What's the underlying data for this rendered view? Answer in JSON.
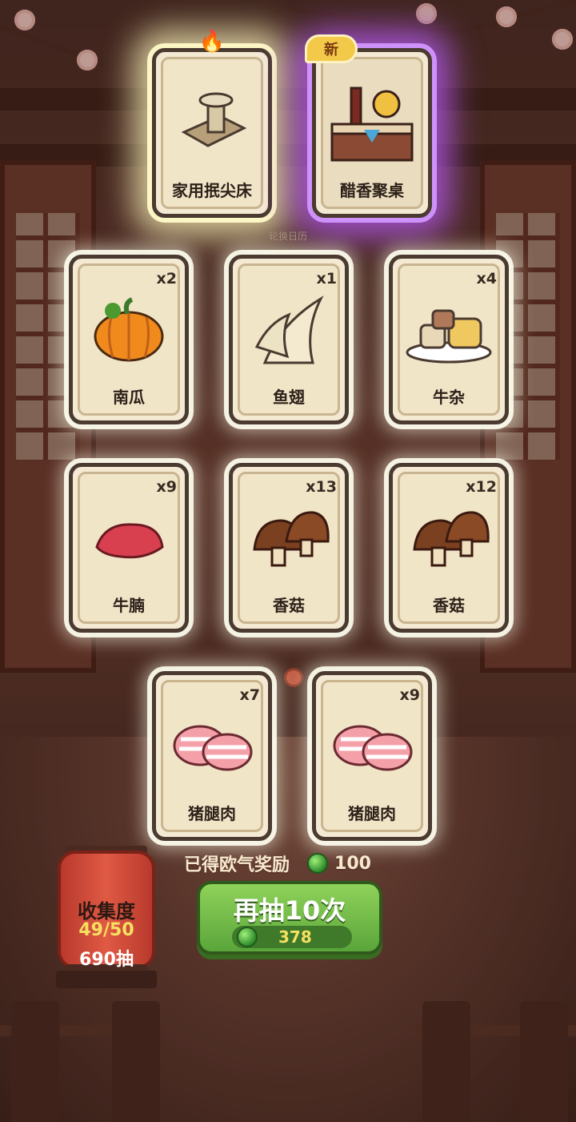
{
  "top_cards": [
    {
      "label": "家用抿尖床",
      "badge": "",
      "effect": "gold",
      "icon": "noodle-press-icon"
    },
    {
      "label": "醋香聚桌",
      "badge": "新",
      "effect": "purple",
      "icon": "vinegar-table-icon"
    }
  ],
  "calendar_label": "轮换日历",
  "cards": [
    {
      "label": "南瓜",
      "count": "x2",
      "icon": "pumpkin-icon"
    },
    {
      "label": "鱼翅",
      "count": "x1",
      "icon": "shark-fin-icon"
    },
    {
      "label": "牛杂",
      "count": "x4",
      "icon": "beef-offal-icon"
    },
    {
      "label": "牛腩",
      "count": "x9",
      "icon": "beef-brisket-icon"
    },
    {
      "label": "香菇",
      "count": "x13",
      "icon": "shiitake-icon"
    },
    {
      "label": "香菇",
      "count": "x12",
      "icon": "shiitake-icon"
    },
    {
      "label": "猪腿肉",
      "count": "x7",
      "icon": "pork-leg-icon"
    },
    {
      "label": "猪腿肉",
      "count": "x9",
      "icon": "pork-leg-icon"
    }
  ],
  "reward": {
    "label": "已得欧气奖励",
    "value": "100"
  },
  "collection": {
    "title": "收集度",
    "progress": "49/50",
    "draws": "690抽"
  },
  "draw_button": {
    "label": "再抽10次",
    "cost": "378"
  },
  "colors": {
    "button_green": "#6fbb45",
    "lantern_red": "#d04a38",
    "gem_green": "#3a9a30"
  }
}
